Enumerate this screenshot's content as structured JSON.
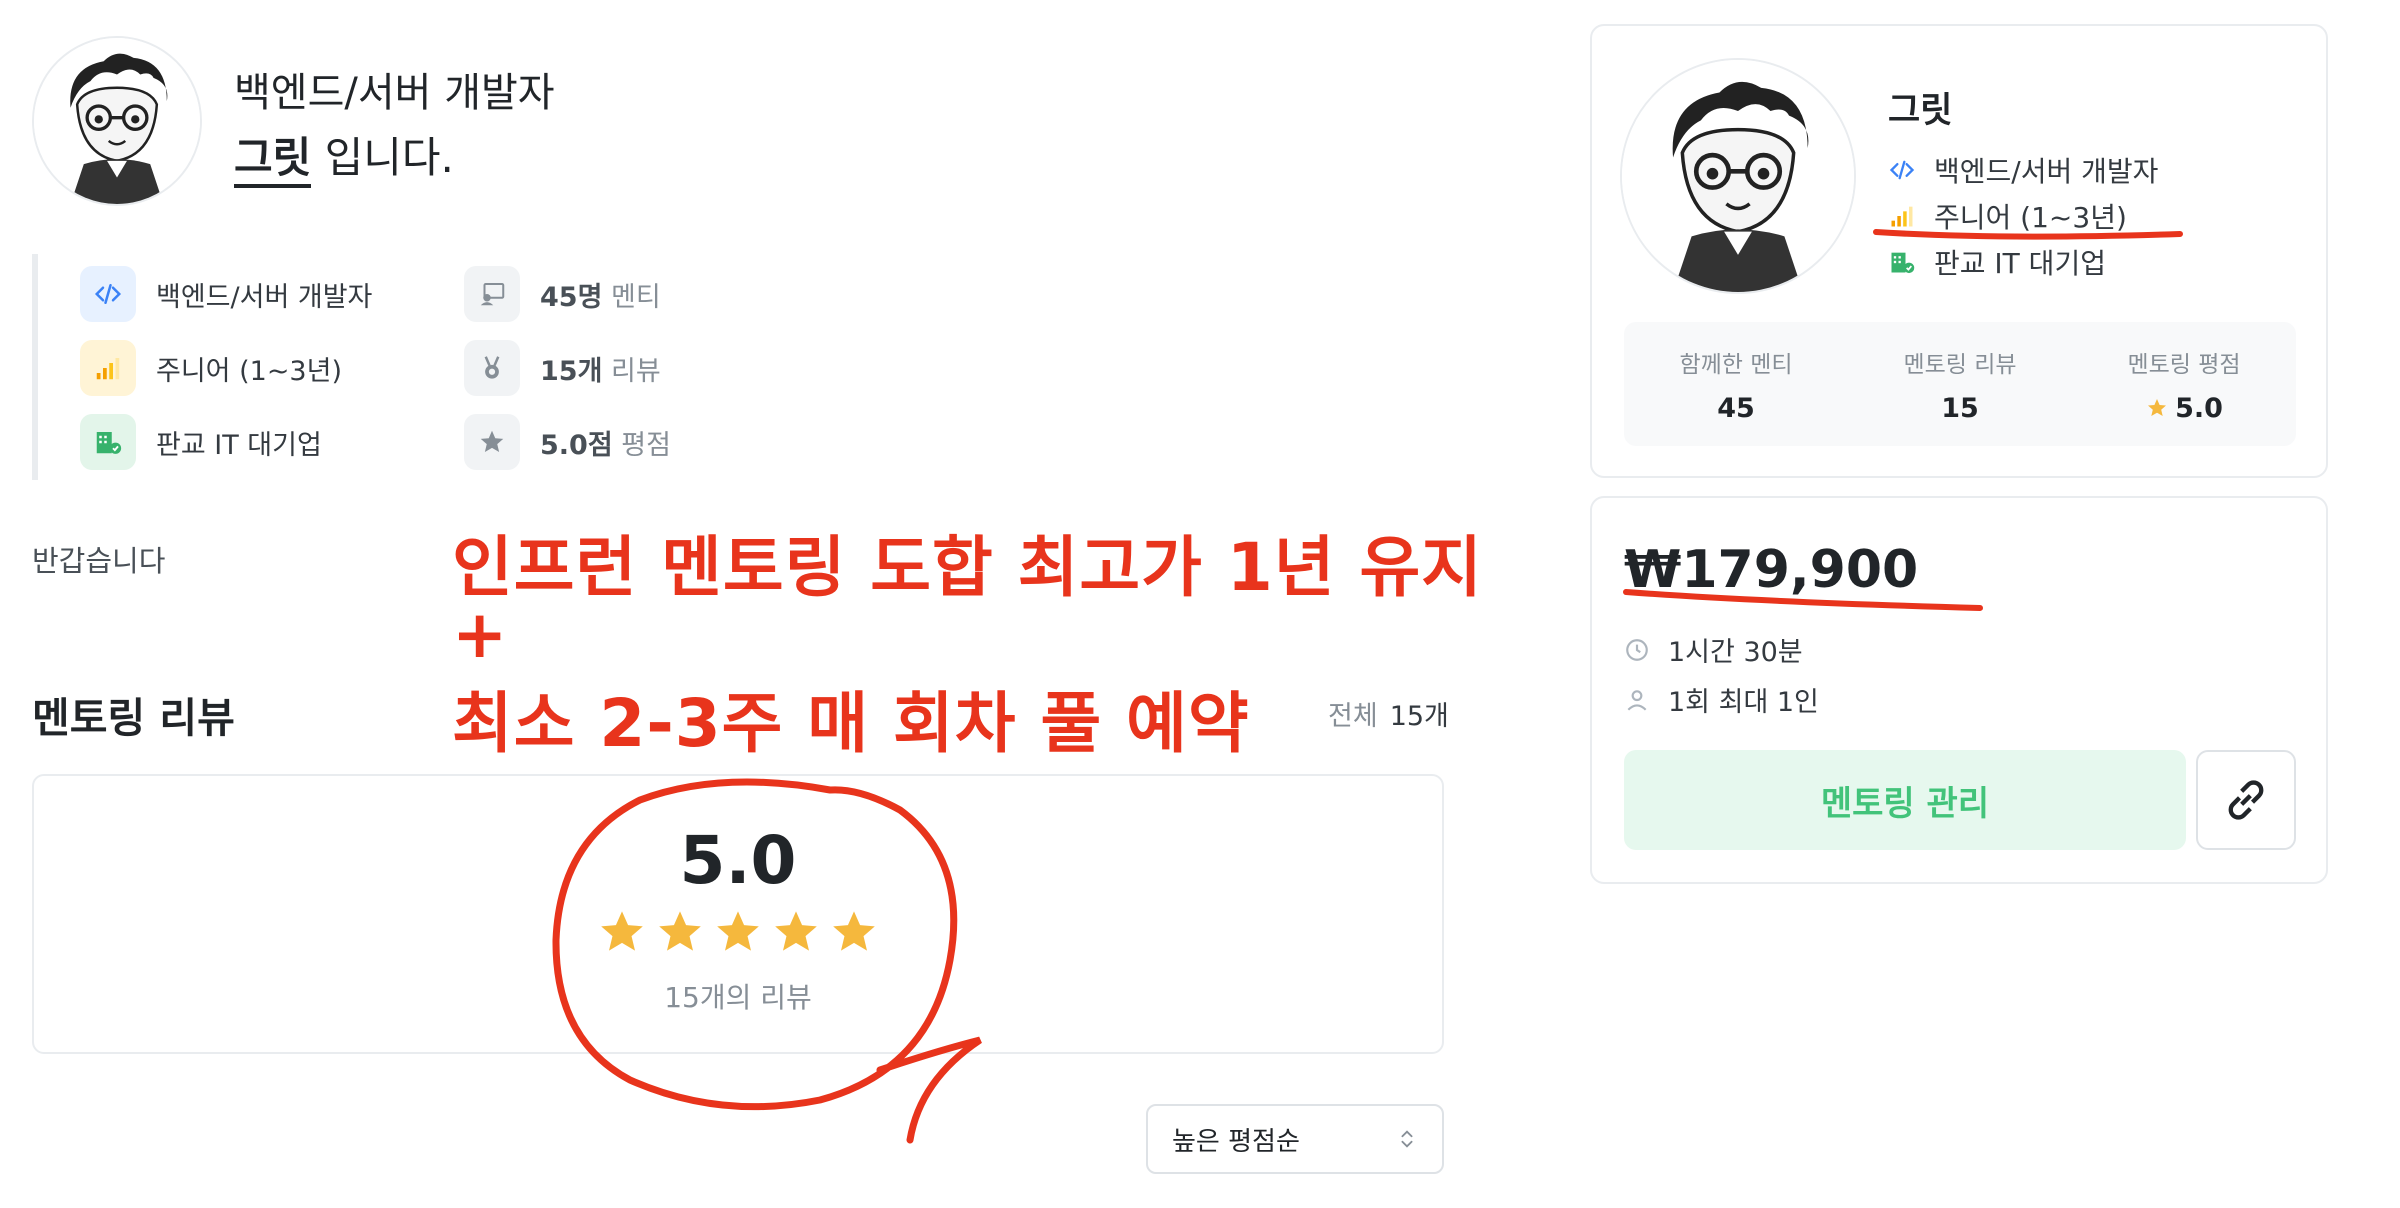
{
  "header": {
    "role": "백엔드/서버 개발자",
    "name": "그릿",
    "name_suffix": " 입니다."
  },
  "info": {
    "left": [
      {
        "icon": "code-icon",
        "text": "백엔드/서버 개발자"
      },
      {
        "icon": "signal-bars-icon",
        "text": "주니어 (1~3년)"
      },
      {
        "icon": "company-building-icon",
        "text": "판교 IT 대기업"
      }
    ],
    "right": [
      {
        "icon": "mentee-icon",
        "bold": "45명",
        "gray": " 멘티"
      },
      {
        "icon": "medal-icon",
        "bold": "15개",
        "gray": " 리뷰"
      },
      {
        "icon": "star-icon",
        "bold": "5.0점",
        "gray": " 평점"
      }
    ]
  },
  "greeting": "반갑습니다",
  "annotation": {
    "line1": "인프런 멘토링 도합 최고가 1년 유지",
    "line2": "+",
    "line3": "최소 2-3주 매 회차 풀 예약"
  },
  "reviews": {
    "title": "멘토링 리뷰",
    "total_label": "전체",
    "total_count": "15개",
    "score": "5.0",
    "stars": 5,
    "count_text": "15개의 리뷰",
    "sort_selected": "높은 평점순"
  },
  "profile_card": {
    "name": "그릿",
    "role": "백엔드/서버 개발자",
    "level": "주니어 (1~3년)",
    "company": "판교 IT 대기업",
    "stats": [
      {
        "label": "함께한 멘티",
        "value": "45"
      },
      {
        "label": "멘토링 리뷰",
        "value": "15"
      },
      {
        "label": "멘토링 평점",
        "value": "5.0"
      }
    ]
  },
  "price_card": {
    "price": "₩179,900",
    "duration": "1시간 30분",
    "capacity": "1회 최대 1인",
    "manage_button": "멘토링 관리"
  },
  "colors": {
    "annotation_red": "#e8341c",
    "star_yellow": "#f5b83d",
    "green": "#42c37a",
    "code_blue": "#3b82f6"
  }
}
